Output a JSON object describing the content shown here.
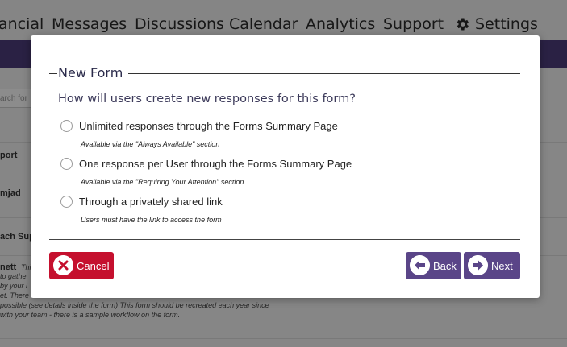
{
  "nav": {
    "items": [
      "ancial",
      "Messages",
      "Discussions",
      "Calendar",
      "Analytics",
      "Support",
      "Settings"
    ]
  },
  "background": {
    "search_placeholder": "arch for",
    "rows": [
      "port",
      "mjad",
      "ach Sup",
      "nett"
    ],
    "desc_lines": [
      "This",
      "to gathe",
      "by your l",
      "et. There",
      "possible (see details inside the form) This form should be recreated each year since",
      "with your team - there is a sample workflow on the form."
    ]
  },
  "modal": {
    "legend": "New Form",
    "question": "How will users create new responses for this form?",
    "options": [
      {
        "label": "Unlimited responses through the Forms Summary Page",
        "hint": "Available via the \"Always Available\" section"
      },
      {
        "label": "One response per User through the Forms Summary Page",
        "hint": "Available via the \"Requiring Your Attention\" section"
      },
      {
        "label": "Through a privately shared link",
        "hint": "Users must have the link to access the form"
      }
    ],
    "cancel_label": "Cancel",
    "back_label": "Back",
    "next_label": "Next"
  },
  "colors": {
    "brand_purple": "#4e3d7c",
    "button_purple": "#5a4588",
    "cancel_red": "#c5102e"
  },
  "icons": {
    "settings": "gear-icon",
    "cancel": "x-circle-icon",
    "back": "arrow-left-circle-icon",
    "next": "arrow-right-circle-icon"
  }
}
